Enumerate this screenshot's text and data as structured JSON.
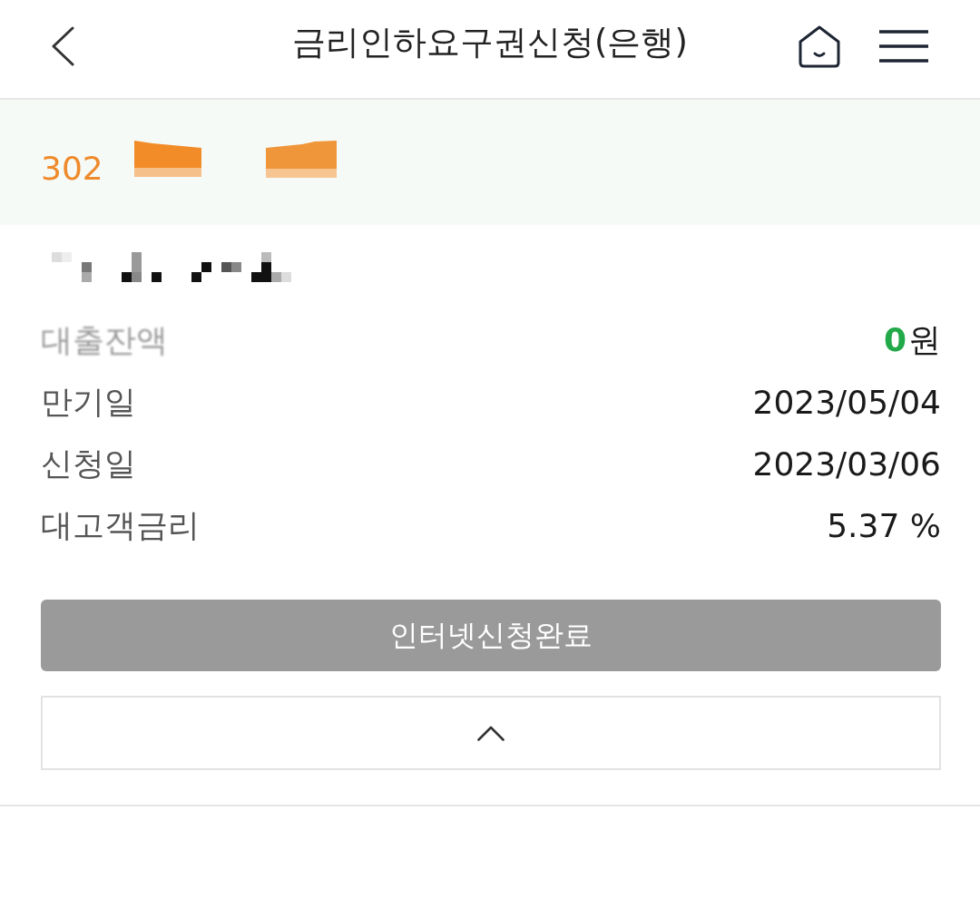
{
  "header": {
    "title": "금리인하요구권신청(은행)"
  },
  "account": {
    "number": "302"
  },
  "details": [
    {
      "kind": "amount",
      "label": "대출잔액",
      "amount": "0",
      "unit": "원"
    },
    {
      "kind": "text",
      "label": "만기일",
      "value": "2023/05/04"
    },
    {
      "kind": "text",
      "label": "신청일",
      "value": "2023/03/06"
    },
    {
      "kind": "text",
      "label": "대고객금리",
      "value": "5.37 %"
    }
  ],
  "action_button": {
    "label": "인터넷신청완료",
    "disabled": true
  },
  "collapse_toggle": {
    "expanded": true
  }
}
